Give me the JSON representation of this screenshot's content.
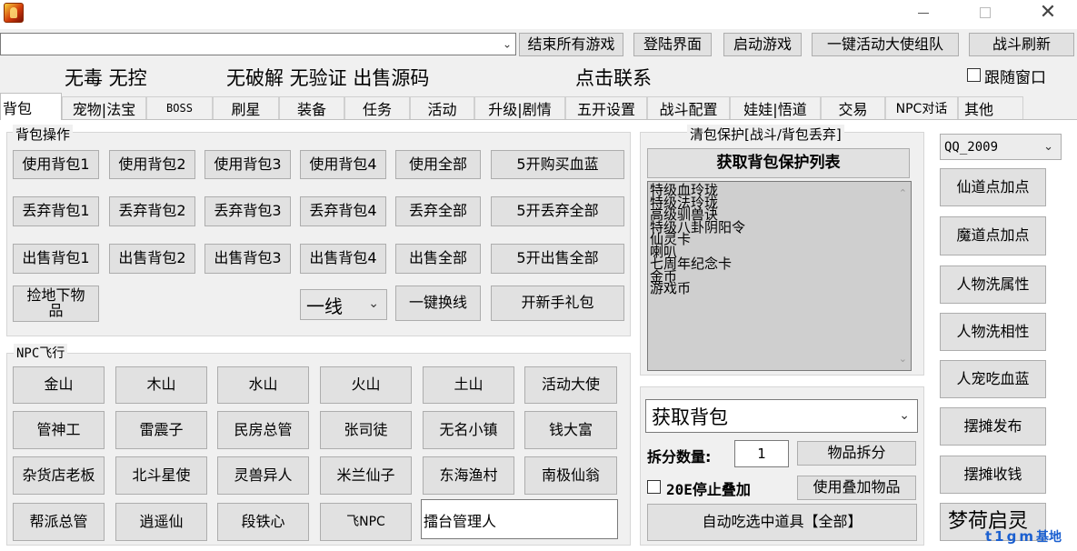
{
  "titlebar": {
    "icon": "app-icon",
    "minimize": "minimize-icon",
    "maximize": "maximize-icon",
    "close_glyph": "✕"
  },
  "toolbar": {
    "combo_value": "",
    "buttons": [
      "结束所有游戏",
      "登陆界面",
      "启动游戏",
      "一键活动大使组队",
      "战斗刷新"
    ]
  },
  "banner": {
    "text1": "无毒 无控",
    "text2": "无破解 无验证  出售源码",
    "text3": "点击联系",
    "follow_window_label": "跟随窗口",
    "follow_window_checked": false
  },
  "tabs": [
    "背包",
    "宠物|法宝",
    "BOSS",
    "刷星",
    "装备",
    "任务",
    "活动",
    "升级|剧情",
    "五开设置",
    "战斗配置",
    "娃娃|悟道",
    "交易",
    "NPC对话",
    "其他"
  ],
  "bag_ops": {
    "title": "背包操作",
    "row1": [
      "使用背包1",
      "使用背包2",
      "使用背包3",
      "使用背包4",
      "使用全部",
      "5开购买血蓝"
    ],
    "row2": [
      "丢弃背包1",
      "丢弃背包2",
      "丢弃背包3",
      "丢弃背包4",
      "丢弃全部",
      "5开丢弃全部"
    ],
    "row3": [
      "出售背包1",
      "出售背包2",
      "出售背包3",
      "出售背包4",
      "出售全部",
      "5开出售全部"
    ],
    "pick_up": "捡地下物品",
    "line_select": "一线",
    "switch_line": "一键换线",
    "gift_pack": "开新手礼包"
  },
  "npc_fly": {
    "title": "NPC飞行",
    "rows": [
      [
        "金山",
        "木山",
        "水山",
        "火山",
        "土山",
        "活动大使"
      ],
      [
        "管神工",
        "雷震子",
        "民房总管",
        "张司徒",
        "无名小镇",
        "钱大富"
      ],
      [
        "杂货店老板",
        "北斗星使",
        "灵兽异人",
        "米兰仙子",
        "东海渔村",
        "南极仙翁"
      ],
      [
        "帮派总管",
        "逍遥仙",
        "段铁心",
        "飞NPC"
      ]
    ],
    "npc_input": "擂台管理人"
  },
  "protect": {
    "title": "清包保护[战斗/背包丢弃]",
    "get_list_button": "获取背包保护列表",
    "items": [
      "特级血玲珑",
      "特级法玲珑",
      "高级驯兽诀",
      "特级八卦阴阳令",
      "仙灵卡",
      "喇叭",
      "七周年纪念卡",
      "金币",
      "游戏币"
    ]
  },
  "bag_split": {
    "get_bag": "获取背包",
    "split_count_label": "拆分数量:",
    "split_count_value": "1",
    "split_button": "物品拆分",
    "stop_stack_label": "20E停止叠加",
    "stop_stack_checked": false,
    "use_stack_button": "使用叠加物品",
    "auto_eat_button": "自动吃选中道具【全部】"
  },
  "right_panel": {
    "account": "QQ_2009",
    "buttons": [
      "仙道点加点",
      "魔道点加点",
      "人物洗属性",
      "人物洗相性",
      "人宠吃血蓝",
      "摆摊发布",
      "摆摊收钱",
      "梦荷启灵"
    ]
  },
  "watermark": {
    "latin": "t1gm",
    "cn": "基地"
  }
}
